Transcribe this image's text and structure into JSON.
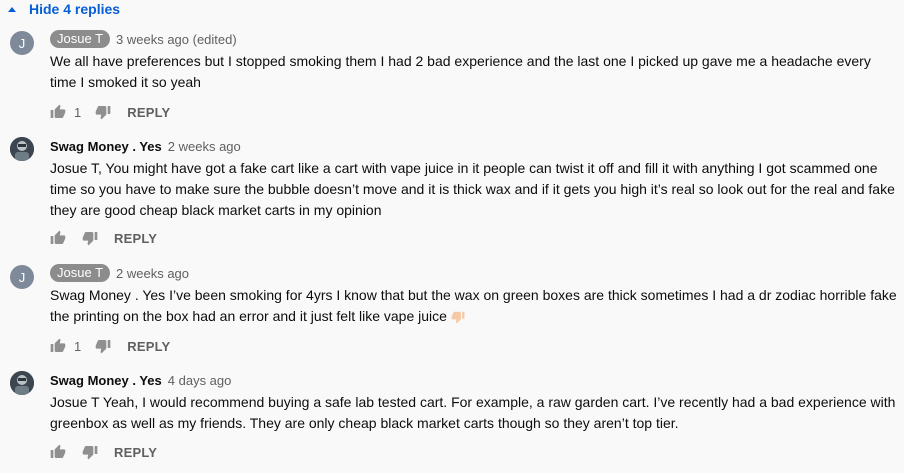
{
  "thread": {
    "toggle_label": "Hide 4 replies"
  },
  "comments": [
    {
      "author": "Josue T",
      "avatar_letter": "J",
      "time": "3 weeks ago (edited)",
      "text": "We all have preferences but I stopped smoking them I had 2 bad experience and the last one I picked up gave me a headache every time I smoked it so yeah",
      "likes": "1",
      "reply_label": "REPLY"
    },
    {
      "author": "Swag Money . Yes",
      "time": "2 weeks ago",
      "text": "Josue T, You might have got a fake cart like a cart with vape juice in it people can twist it off and fill it with anything I got scammed one time so you have to make sure the bubble doesn’t move and it is thick wax and if it gets you high it’s real so look out for the real and fake they are good cheap black market carts in my opinion",
      "reply_label": "REPLY"
    },
    {
      "author": "Josue T",
      "avatar_letter": "J",
      "time": "2 weeks ago",
      "text": "Swag Money . Yes I’ve been smoking for 4yrs I know that but the wax on green boxes are thick sometimes I had a dr zodiac horrible fake the printing on the box had an error and it just felt like vape juice",
      "likes": "1",
      "reply_label": "REPLY"
    },
    {
      "author": "Swag Money . Yes",
      "time": "4 days ago",
      "text": "Josue T Yeah, I would recommend buying a safe lab tested cart. For example, a raw garden cart. I’ve recently had a bad experience with greenbox as well as my friends. They are only cheap black market carts though so they aren’t top tier.",
      "reply_label": "REPLY"
    }
  ],
  "icons": {
    "caret": "caret-up-icon",
    "like": "thumbs-up-icon",
    "dislike": "thumbs-down-icon",
    "emoji": "thumbs-down-emoji"
  },
  "colors": {
    "link": "#065fd4",
    "secondary_text": "#606060",
    "author_chip": "#8c8c8c",
    "avatar": "#7e8a9a",
    "background": "#f9f9f9"
  }
}
